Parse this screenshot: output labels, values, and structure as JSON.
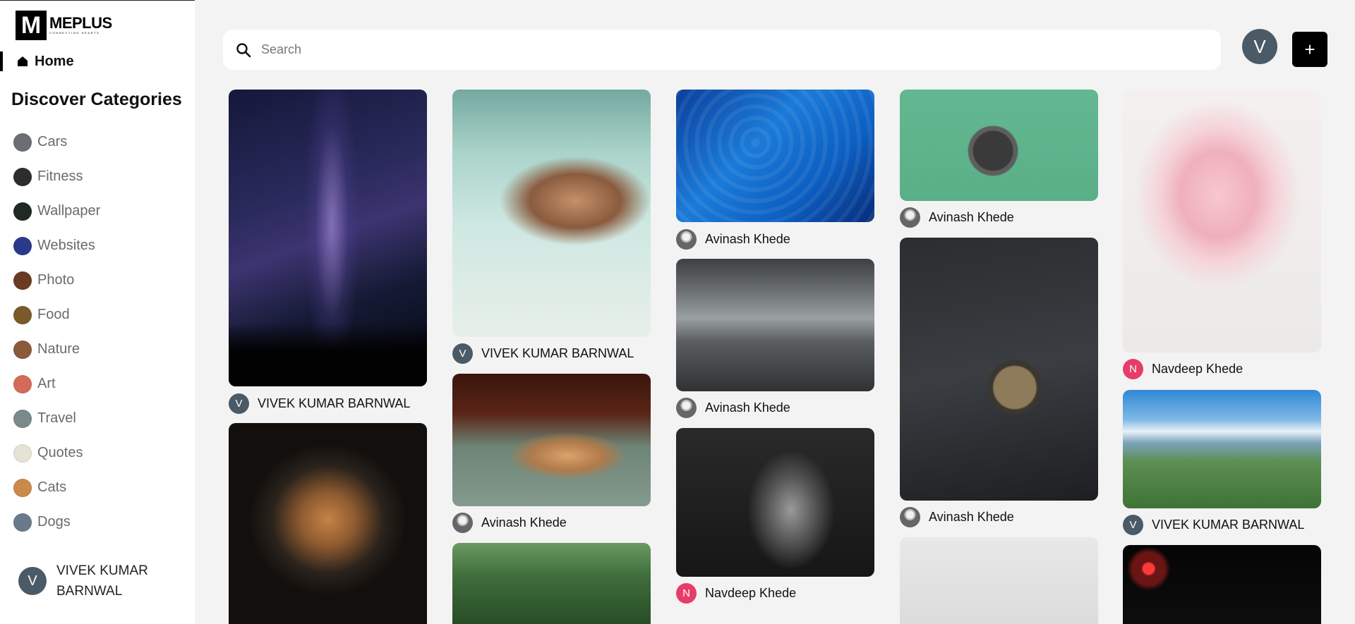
{
  "brand": {
    "mark": "M",
    "name": "MEPLUS",
    "tagline": "CONNECTING HEARTS"
  },
  "nav": {
    "home_label": "Home"
  },
  "categories": {
    "title": "Discover Categories",
    "items": [
      {
        "label": "Cars",
        "thumb_color": "#6b6f73"
      },
      {
        "label": "Fitness",
        "thumb_color": "#2d2d2d"
      },
      {
        "label": "Wallpaper",
        "thumb_color": "#1f2a22"
      },
      {
        "label": "Websites",
        "thumb_color": "#2a3a8a"
      },
      {
        "label": "Photo",
        "thumb_color": "#6b3a22"
      },
      {
        "label": "Food",
        "thumb_color": "#7a5a2a"
      },
      {
        "label": "Nature",
        "thumb_color": "#8a5a3a"
      },
      {
        "label": "Art",
        "thumb_color": "#d46a5a"
      },
      {
        "label": "Travel",
        "thumb_color": "#7a8a8a"
      },
      {
        "label": "Quotes",
        "thumb_color": "#e5e2d6"
      },
      {
        "label": "Cats",
        "thumb_color": "#c98a4a"
      },
      {
        "label": "Dogs",
        "thumb_color": "#6a7a8a"
      }
    ]
  },
  "sidebar_user": {
    "initial": "V",
    "name": "VIVEK KUMAR BARNWAL"
  },
  "search": {
    "placeholder": "Search",
    "value": ""
  },
  "header": {
    "avatar_initial": "V",
    "add_label": "+"
  },
  "pins": [
    {
      "author": "VIVEK KUMAR BARNWAL",
      "initial": "V"
    },
    {
      "author": "VIVEK KUMAR BARNWAL",
      "initial": "V"
    },
    {
      "author": "Avinash Khede",
      "initial": ""
    },
    {
      "author": "Avinash Khede",
      "initial": ""
    },
    {
      "author": "Navdeep Khede",
      "initial": "N"
    },
    {
      "author": "Avinash Khede",
      "initial": ""
    },
    {
      "author": "Avinash Khede",
      "initial": ""
    },
    {
      "author": "VIVEK KUMAR BARNWAL",
      "initial": "V"
    },
    {
      "author": "Avinash Khede",
      "initial": ""
    },
    {
      "author": "Navdeep Khede",
      "initial": "N"
    }
  ]
}
